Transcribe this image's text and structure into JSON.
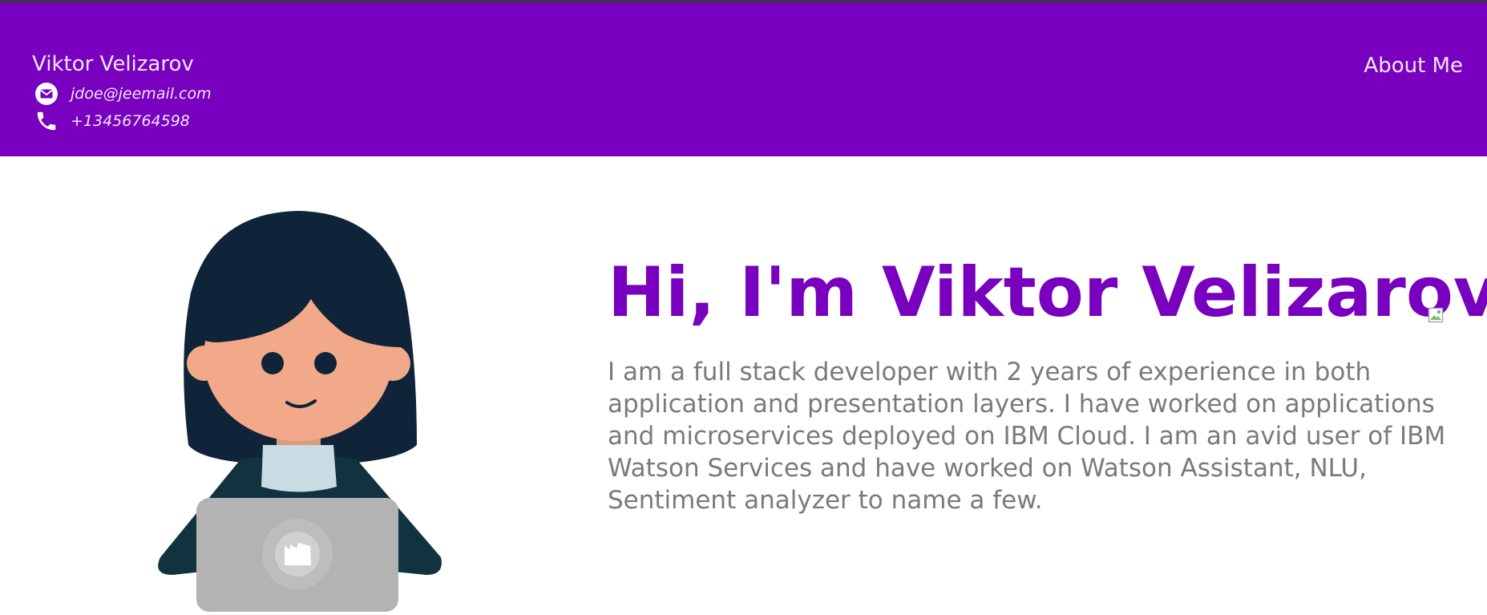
{
  "header": {
    "name": "Viktor Velizarov",
    "email": "jdoe@jeemail.com",
    "phone": "+13456764598",
    "nav_about": "About Me",
    "icons": {
      "email": "envelope-icon",
      "phone": "phone-icon"
    }
  },
  "hero": {
    "title": "Hi, I'm Viktor Velizarov!",
    "bio": "I am a full stack developer with 2 years of experience in both application and presentation layers. I have worked on applications and microservices deployed on IBM Cloud. I am an avid user of IBM Watson Services and have worked on Watson Assistant, NLU, Sentiment analyzer to name a few.",
    "illustration": "developer-with-laptop-illustration"
  },
  "colors": {
    "brand_purple": "#7800be",
    "header_text": "#f1e6fb",
    "bio_gray": "#7a7a7a"
  }
}
